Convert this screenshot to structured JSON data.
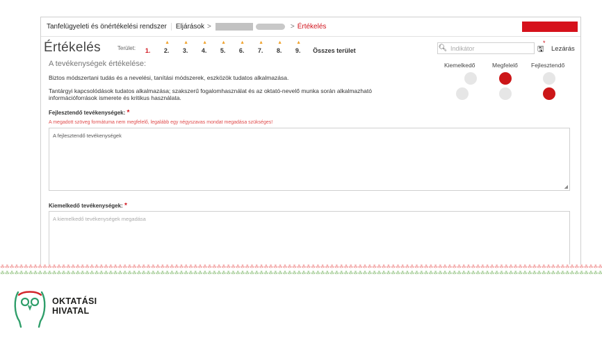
{
  "topbar": {
    "app_name": "Tanfelügyeleti és önértékelési rendszer",
    "crumb_procedures": "Eljárások",
    "separator": ">",
    "current": "Értékelés"
  },
  "header": {
    "title": "Értékelés",
    "area_label": "Terület:",
    "areas": [
      "1.",
      "2.",
      "3.",
      "4.",
      "5.",
      "6.",
      "7.",
      "8.",
      "9."
    ],
    "active_area": "1.",
    "all_areas": "Összes terület",
    "search_placeholder": "Indikátor",
    "close_label": "Lezárás"
  },
  "evaluation": {
    "heading": "A tevékenységek értékelése:",
    "columns": [
      "Kiemelkedő",
      "Megfelelő",
      "Fejlesztendő"
    ],
    "rows": [
      {
        "text": "Biztos módszertani tudás és a nevelési, tanítási módszerek, eszközök tudatos alkalmazása.",
        "selected": "Megfelelő"
      },
      {
        "text": "Tantárgyi kapcsolódások tudatos alkalmazása; szakszerű fogalomhasználat és az oktató-nevelő munka során alkalmazható információforrások ismerete és kritikus használata.",
        "selected": "Fejlesztendő"
      }
    ]
  },
  "fields": {
    "develop_label": "Fejlesztendő tevékenységek:",
    "required_mark": "*",
    "develop_error": "A megadott szöveg formátuma nem megfelelő, legalább egy négyszavas mondat megadása szükséges!",
    "develop_value": "A fejlesztendő tevékenységek",
    "outstanding_label": "Kiemelkedő tevékenységek:",
    "outstanding_placeholder": "A kiemelkedő tevékenységek megadása"
  },
  "colors": {
    "accent_red": "#cc1618",
    "warning_orange": "#f0a22b"
  },
  "footer": {
    "logo_line1": "OKTATÁSI",
    "logo_line2": "HIVATAL"
  }
}
